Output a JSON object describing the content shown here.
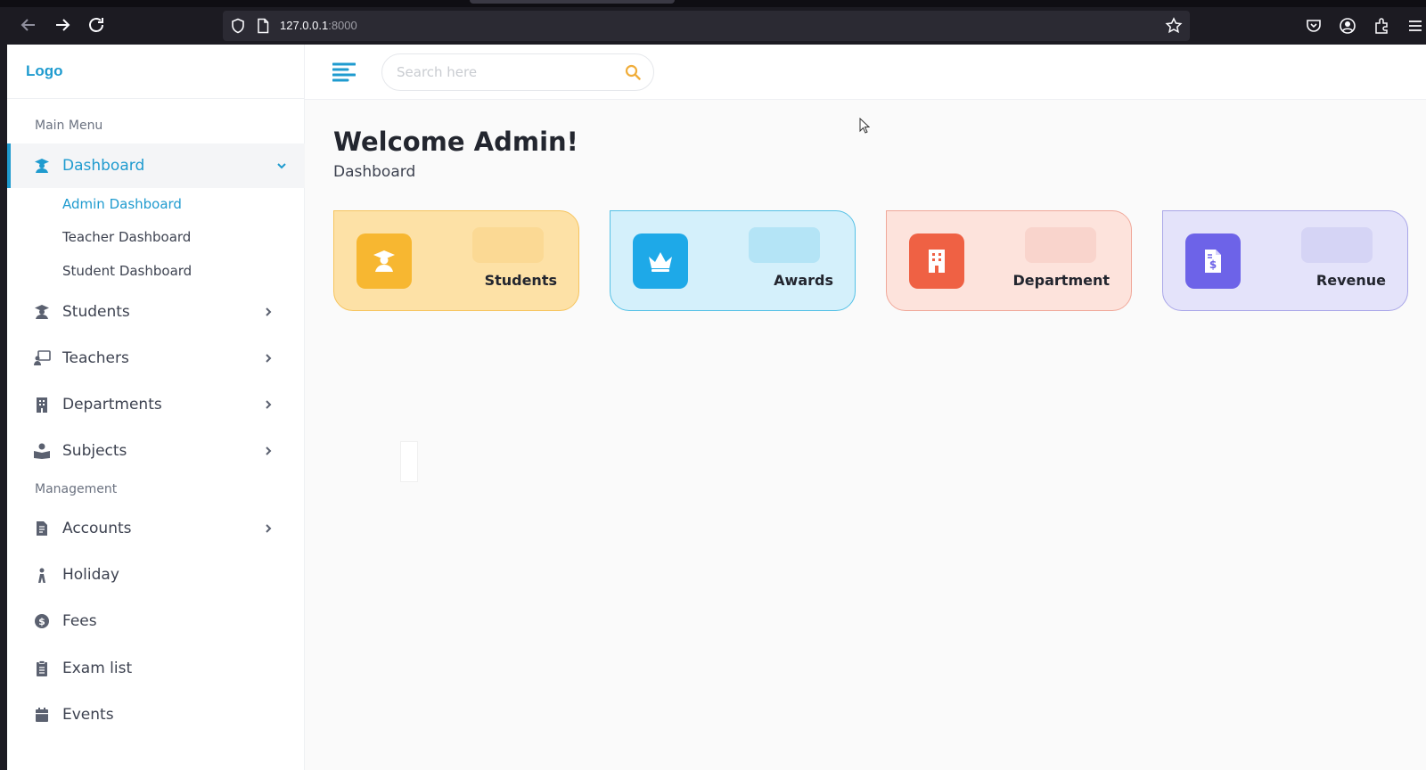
{
  "browser": {
    "url_host": "127.0.0.1",
    "url_port": ":8000"
  },
  "sidebar": {
    "logo": "Logo",
    "main_menu_title": "Main Menu",
    "management_title": "Management",
    "dashboard": {
      "label": "Dashboard",
      "icon": "graduate-icon",
      "submenu": [
        "Admin Dashboard",
        "Teacher Dashboard",
        "Student Dashboard"
      ]
    },
    "items": [
      {
        "label": "Students",
        "icon": "student-icon"
      },
      {
        "label": "Teachers",
        "icon": "teacher-icon"
      },
      {
        "label": "Departments",
        "icon": "building-icon"
      },
      {
        "label": "Subjects",
        "icon": "book-reader-icon"
      }
    ],
    "management_items": [
      {
        "label": "Accounts",
        "icon": "file-invoice-icon"
      },
      {
        "label": "Holiday",
        "icon": "holiday-icon"
      },
      {
        "label": "Fees",
        "icon": "dollar-icon"
      },
      {
        "label": "Exam list",
        "icon": "clipboard-icon"
      },
      {
        "label": "Events",
        "icon": "calendar-icon"
      }
    ]
  },
  "search": {
    "placeholder": "Search here"
  },
  "page": {
    "title": "Welcome Admin!",
    "breadcrumb": "Dashboard"
  },
  "cards": [
    {
      "label": "Students",
      "icon": "graduate-icon",
      "bg": "#fde1a6",
      "border": "#f6c45e",
      "icon_bg": "#f7b731"
    },
    {
      "label": "Awards",
      "icon": "crown-icon",
      "bg": "#d4f0fb",
      "border": "#55c1e6",
      "icon_bg": "#1ea9e8"
    },
    {
      "label": "Department",
      "icon": "building-icon",
      "bg": "#fde3dc",
      "border": "#f0a89a",
      "icon_bg": "#ef6144"
    },
    {
      "label": "Revenue",
      "icon": "dollar-file-icon",
      "bg": "#e4e3fa",
      "border": "#a9a6e8",
      "icon_bg": "#6d63e8"
    }
  ],
  "colors": {
    "accent": "#1f9bcf",
    "text_dark": "#23262f",
    "text_body": "#3d4250"
  }
}
